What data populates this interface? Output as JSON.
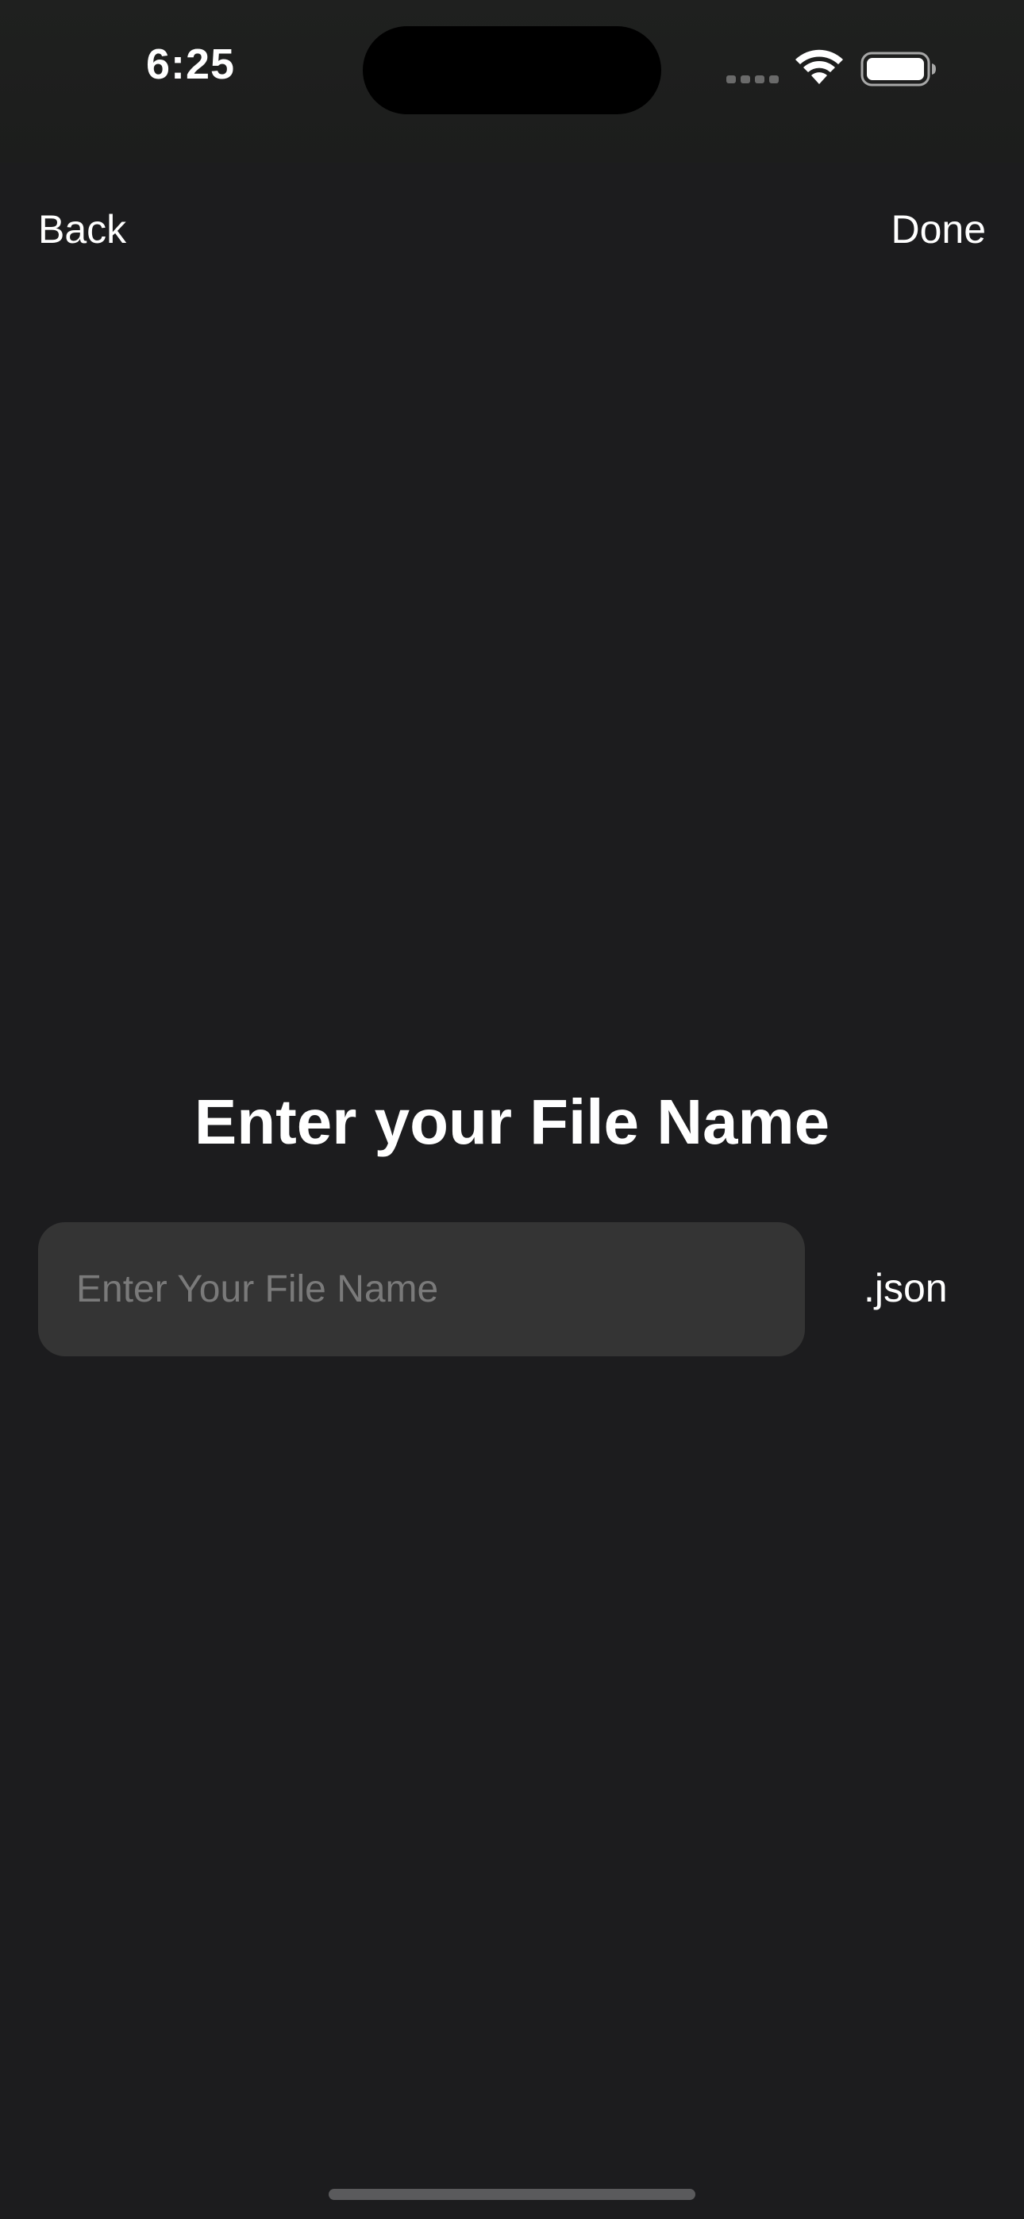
{
  "status_bar": {
    "time": "6:25",
    "icons": [
      "cellular-signal-icon",
      "wifi-icon",
      "battery-icon"
    ]
  },
  "nav": {
    "back_label": "Back",
    "done_label": "Done"
  },
  "main": {
    "title": "Enter your File Name",
    "file_name_input": {
      "value": "",
      "placeholder": "Enter Your File Name"
    },
    "extension": ".json"
  },
  "colors": {
    "background": "#1c1c1e",
    "input_background": "#343434",
    "placeholder": "#7a7a7a",
    "text": "#ffffff"
  }
}
